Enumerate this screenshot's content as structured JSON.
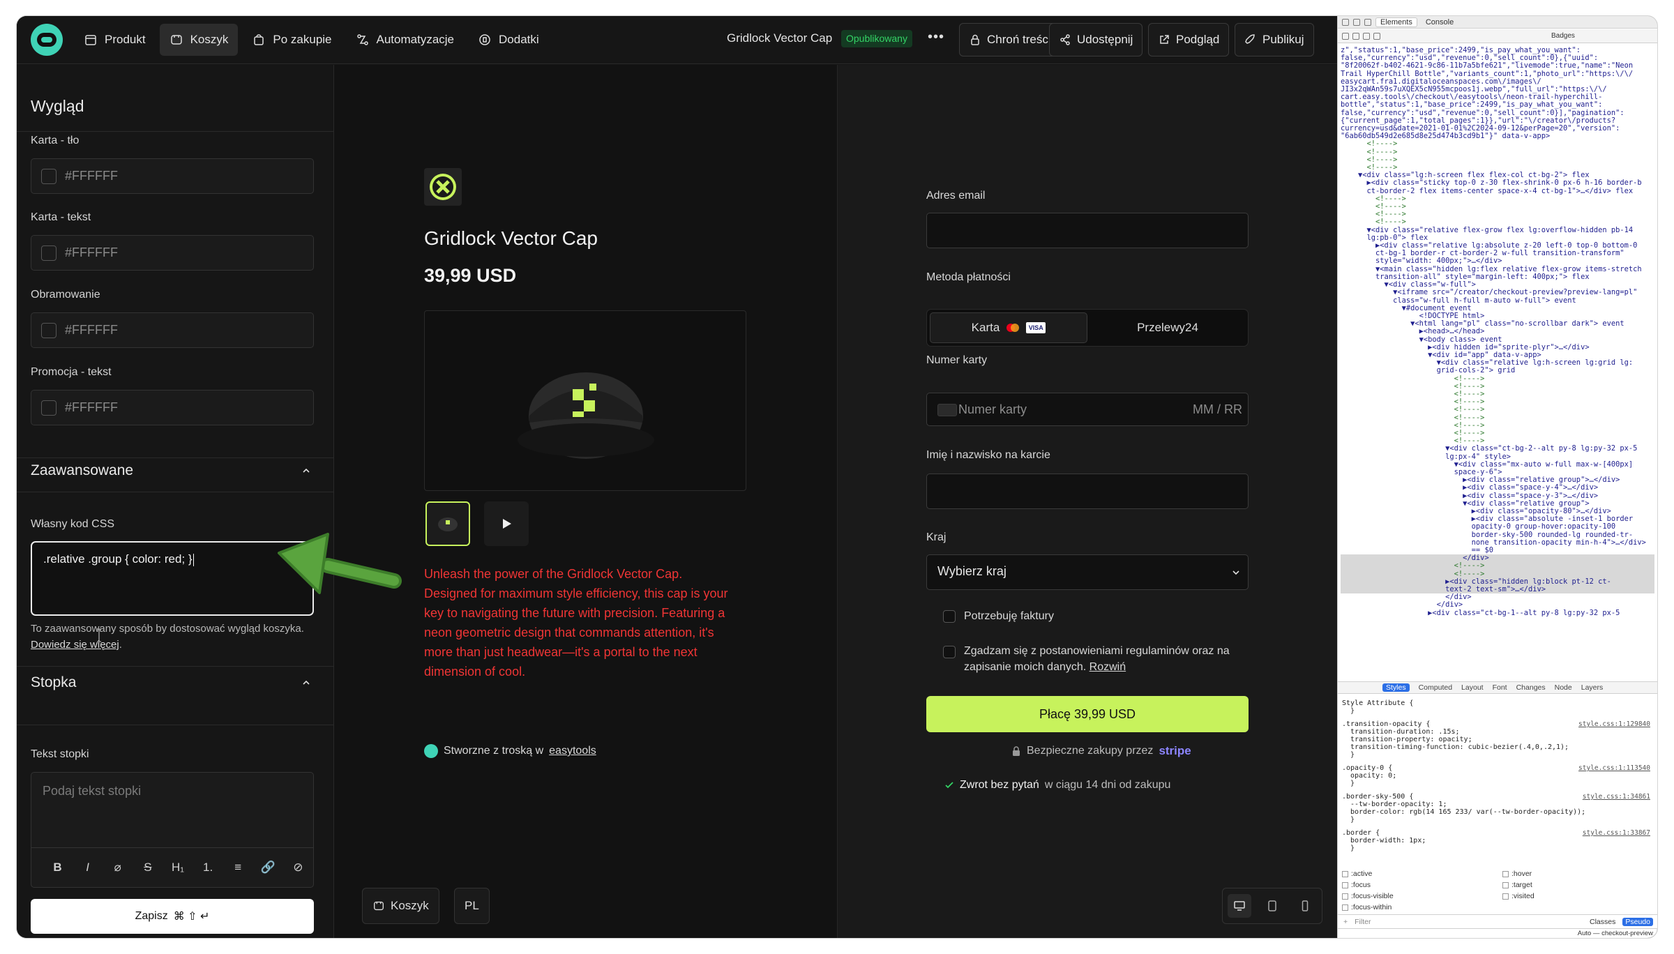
{
  "topbar": {
    "nav": [
      {
        "label": "Produkt",
        "icon": "box-icon",
        "active": false
      },
      {
        "label": "Koszyk",
        "icon": "cart-icon",
        "active": true
      },
      {
        "label": "Po zakupie",
        "icon": "bag-icon",
        "active": false
      },
      {
        "label": "Automatyzacje",
        "icon": "automation-icon",
        "active": false
      },
      {
        "label": "Dodatki",
        "icon": "puzzle-icon",
        "active": false
      }
    ],
    "product_title": "Gridlock Vector Cap",
    "status": "Opublikowany",
    "more": "•••",
    "actions": {
      "protect": "Chroń treści",
      "share": "Udostępnij",
      "preview": "Podgląd",
      "publish": "Publikuj"
    }
  },
  "left_panel": {
    "heading": "Wygląd",
    "fields": [
      {
        "label": "Karta - tło",
        "value": "#FFFFFF"
      },
      {
        "label": "Karta - tekst",
        "value": "#FFFFFF"
      },
      {
        "label": "Obramowanie",
        "value": "#FFFFFF"
      },
      {
        "label": "Promocja - tekst",
        "value": "#FFFFFF"
      }
    ],
    "advanced": {
      "title": "Zaawansowane",
      "css_label": "Własny kod CSS",
      "css_value": ".relative .group { color: red; }",
      "help": "To zaawansowany sposób by dostosować wygląd koszyka. ",
      "help_link": "Dowiedz się więcej",
      "help_end": "."
    },
    "footer": {
      "title": "Stopka",
      "text_label": "Tekst stopki",
      "placeholder": "Podaj tekst stopki",
      "toolbar": [
        "B",
        "I",
        "⌀",
        "S",
        "H₁",
        "1.",
        "≡",
        "🔗",
        "⊘"
      ]
    },
    "save": {
      "label": "Zapisz",
      "shortcut": "⌘ ⇧ ↵"
    }
  },
  "preview": {
    "product_name": "Gridlock Vector Cap",
    "price": "39,99 USD",
    "description": "Unleash the power of the Gridlock Vector Cap. Designed for maximum style efficiency, this cap is your key to navigating the future with precision. Featuring a neon geometric design that commands attention, it's more than just headwear—it's a portal to the next dimension of cool.",
    "made_with_prefix": "Stworzne z troską w",
    "made_with_brand": "easytools",
    "bottom": {
      "cart": "Koszyk",
      "lang": "PL"
    },
    "desc_color": "#ef3535"
  },
  "checkout": {
    "email_label": "Adres email",
    "method_label": "Metoda płatności",
    "method_card": "Karta",
    "method_p24": "Przelewy24",
    "visa": "VISA",
    "card_label": "Numer karty",
    "card_placeholder": "Numer karty",
    "card_expiry": "MM / RR",
    "name_label": "Imię i nazwisko na karcie",
    "country_label": "Kraj",
    "country_value": "Wybierz kraj",
    "invoice": "Potrzebuję faktury",
    "terms": "Zgadzam się z postanowieniami regulaminów oraz na zapisanie moich danych. ",
    "terms_link": "Rozwiń",
    "pay_button": "Płacę 39,99 USD",
    "secure_text": "Bezpieczne zakupy przez",
    "secure_brand": "stripe",
    "refund_bold": "Zwrot bez pytań",
    "refund_rest": "w ciągu 14 dni od zakupu",
    "accent": "#c7f25c"
  },
  "devtools": {
    "tabs": [
      "Elements",
      "Console"
    ],
    "badges": "Badges",
    "dom_lines": [
      "z\",\"status\":1,\"base_price\":2499,\"is_pay_what_you_want\":",
      "false,\"currency\":\"usd\",\"revenue\":0,\"sell_count\":0},{\"uuid\":",
      "\"8f20062f-b402-4621-9c86-11b7a5bfe621\",\"livemode\":true,\"name\":\"Neon",
      "Trail HyperChill Bottle\",\"variants_count\":1,\"photo_url\":\"https:\\/\\/",
      "easycart.fra1.digitaloceanspaces.com\\/images\\/",
      "JI3x2qWAn59s7uXQEX5cN955mcpoos1j.webp\",\"full_url\":\"https:\\/\\/",
      "cart.easy.tools\\/checkout\\/easytools\\/neon-trail-hyperchill-",
      "bottle\",\"status\":1,\"base_price\":2499,\"is_pay_what_you_want\":",
      "false,\"currency\":\"usd\",\"revenue\":0,\"sell_count\":0}],\"pagination\":",
      "{\"current_page\":1,\"total_pages\":1}},\"url\":\"\\/creator\\/products?",
      "currency=usd&date=2021-01-01%2C2024-09-12&perPage=20\",\"version\":",
      "\"6ab60db549d2e685d8e25d474b3cd9b1\"}\" data-v-app>",
      "      <!---->",
      "      <!---->",
      "      <!---->",
      "      <!---->",
      "    ▼<div class=\"lg:h-screen flex flex-col ct-bg-2\"> flex",
      "      ▶<div class=\"sticky top-0 z-30 flex-shrink-0 px-6 h-16 border-b",
      "      ct-border-2 flex items-center space-x-4 ct-bg-1\">…</div> flex",
      "        <!---->",
      "        <!---->",
      "        <!---->",
      "        <!---->",
      "      ▼<div class=\"relative flex-grow flex lg:overflow-hidden pb-14",
      "      lg:pb-0\"> flex",
      "        ▶<div class=\"relative lg:absolute z-20 left-0 top-0 bottom-0",
      "        ct-bg-1 border-r ct-border-2 w-full transition-transform\"",
      "        style=\"width: 400px;\">…</div>",
      "        ▼<main class=\"hidden lg:flex relative flex-grow items-stretch",
      "        transition-all\" style=\"margin-left: 400px;\"> flex",
      "          ▼<div class=\"w-full\">",
      "            ▼<iframe src=\"/creator/checkout-preview?preview-lang=pl\"",
      "            class=\"w-full h-full m-auto w-full\"> event",
      "              ▼#document event",
      "                  <!DOCTYPE html>",
      "                ▼<html lang=\"pl\" class=\"no-scrollbar dark\"> event",
      "                  ▶<head>…</head>",
      "                  ▼<body class> event",
      "                    ▶<div hidden id=\"sprite-plyr\">…</div>",
      "                    ▼<div id=\"app\" data-v-app>",
      "                      ▼<div class=\"relative lg:h-screen lg:grid lg:",
      "                      grid-cols-2\"> grid",
      "                          <!---->",
      "                          <!---->",
      "                          <!---->",
      "                          <!---->",
      "                          <!---->",
      "                          <!---->",
      "                          <!---->",
      "                          <!---->",
      "                          <!---->",
      "                        ▼<div class=\"ct-bg-2--alt py-8 lg:py-32 px-5",
      "                        lg:px-4\" style>",
      "                          ▼<div class=\"mx-auto w-full max-w-[400px]",
      "                          space-y-6\">",
      "                            ▶<div class=\"relative group\">…</div>",
      "                            ▶<div class=\"space-y-4\">…</div>",
      "                            ▶<div class=\"space-y-3\">…</div>",
      "                            ▼<div class=\"relative group\">",
      "                              ▶<div class=\"opacity-80\">…</div>",
      "                              ▶<div class=\"absolute -inset-1 border",
      "                              opacity-0 group-hover:opacity-100",
      "                              border-sky-500 rounded-lg rounded-tr-",
      "                              none transition-opacity min-h-4\">…</div>",
      "                              == $0",
      "                            </div>",
      "                          <!---->",
      "                          <!---->",
      "                        ▶<div class=\"hidden lg:block pt-12 ct-",
      "                        text-2 text-sm\">…</div>",
      "                        </div>",
      "                      </div>",
      "                    ▶<div class=\"ct-bg-1--alt py-8 lg:py-32 px-5"
    ],
    "style_tabs": [
      "Styles",
      "Computed",
      "Layout",
      "Font",
      "Changes",
      "Node",
      "Layers"
    ],
    "style_attr": "Style Attribute  {",
    "rules": [
      {
        "sel": ".transition-opacity {",
        "src": "style.css:1:129840",
        "props": [
          "transition-duration: .15s;",
          "transition-property: opacity;",
          "transition-timing-function: cubic-bezier(.4,0,.2,1);"
        ]
      },
      {
        "sel": ".opacity-0 {",
        "src": "style.css:1:113540",
        "props": [
          "opacity: 0;"
        ]
      },
      {
        "sel": ".border-sky-500 {",
        "src": "style.css:1:34861",
        "props": [
          "--tw-border-opacity: 1;",
          "border-color: rgb(14 165 233/ var(--tw-border-opacity));"
        ]
      },
      {
        "sel": ".border {",
        "src": "style.css:1:33867",
        "props": [
          "border-width: 1px;"
        ]
      }
    ],
    "pseudo": [
      ":active",
      ":focus",
      ":focus-visible",
      ":focus-within",
      ":hover",
      ":target",
      ":visited"
    ],
    "filter": "Filter",
    "classes": "Classes",
    "pseudo_btn": "Pseudo",
    "status": "Auto — checkout-preview"
  }
}
